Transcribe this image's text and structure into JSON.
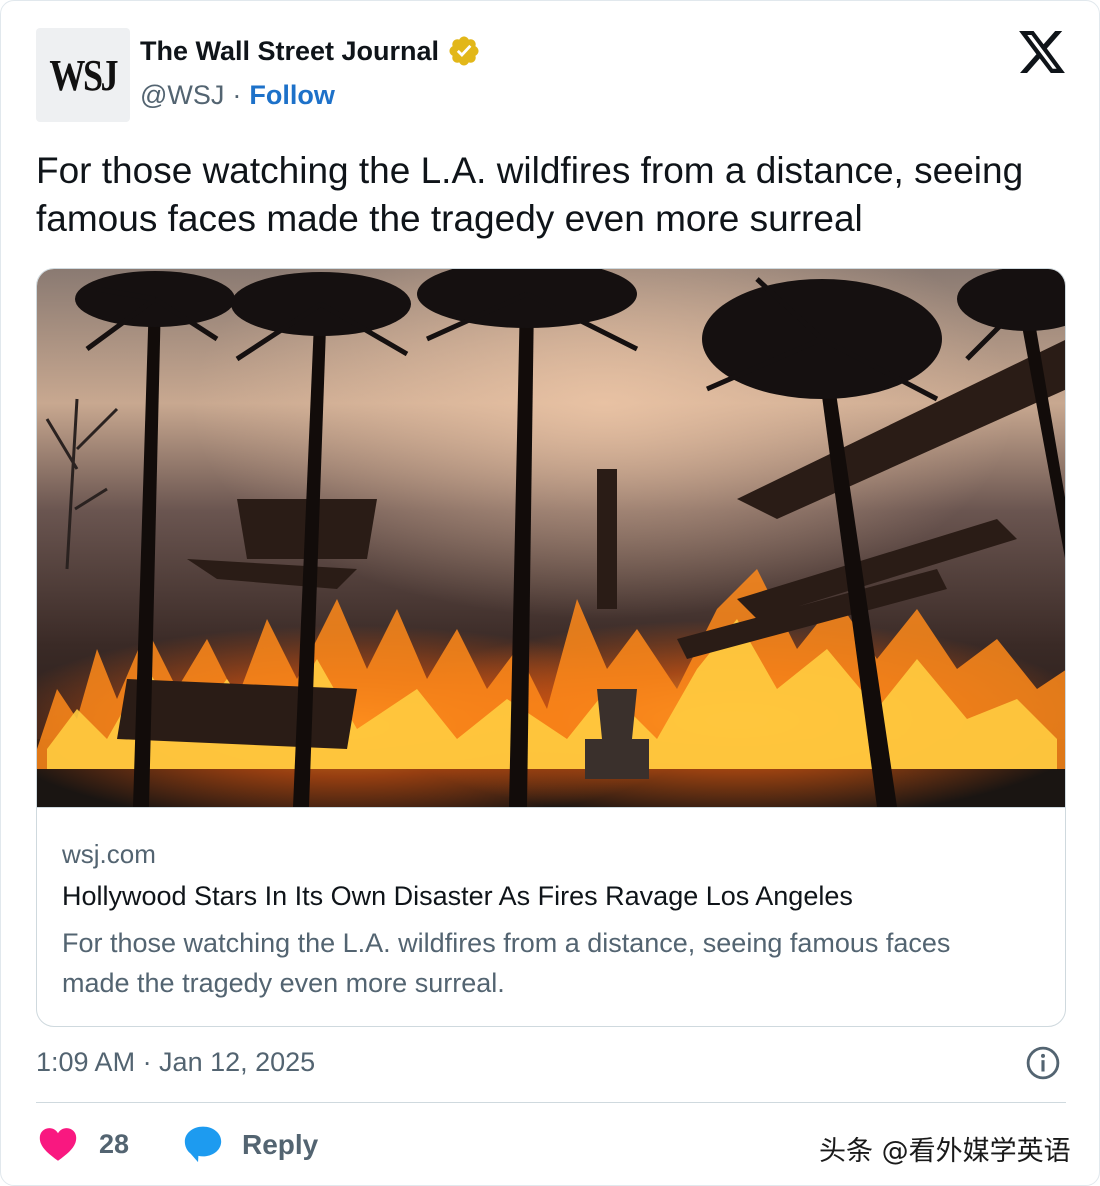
{
  "author": {
    "avatar_text": "WSJ",
    "name": "The Wall Street Journal",
    "handle": "@WSJ",
    "separator": "·",
    "follow_label": "Follow",
    "verified_icon": "verified-badge-icon",
    "verified_color": "#e2b719"
  },
  "platform_icon": "x-logo-icon",
  "tweet": {
    "text": "For those watching the L.A. wildfires from a distance, seeing famous faces made the tragedy even more surreal"
  },
  "link_card": {
    "domain": "wsj.com",
    "title": "Hollywood Stars In Its Own Disaster As Fires Ravage Los Angeles",
    "description": "For those watching the L.A. wildfires from a distance, seeing famous faces made the tragedy even more surreal."
  },
  "meta": {
    "timestamp": "1:09 AM · Jan 12, 2025",
    "info_icon": "info-icon"
  },
  "actions": {
    "like_icon": "heart-icon",
    "like_count": "28",
    "like_color": "#f91880",
    "reply_icon": "speech-bubble-icon",
    "reply_label": "Reply",
    "reply_color": "#1d9bf0"
  },
  "watermark": {
    "text": "头条 @看外媒学英语"
  },
  "colors": {
    "follow": "#1d71c9",
    "secondary_text": "#536471",
    "border": "#cfd9de"
  }
}
